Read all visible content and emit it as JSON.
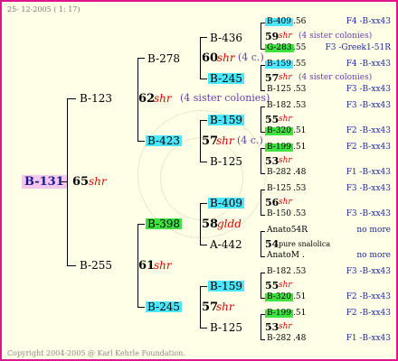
{
  "header": "25- 12-2005 ( 1: 17)",
  "footer": "Copyright 2004-2005 @ Karl Kehrle Foundation.",
  "root": {
    "code": "B-131",
    "gen": "65",
    "label": "shr"
  },
  "gen1": [
    {
      "code": "B-123",
      "gen": "62",
      "label": "shr",
      "note": "(4 sister colonies)"
    },
    {
      "code": "B-255",
      "gen": "61",
      "label": "shr"
    }
  ],
  "gen2": [
    {
      "code": "B-278",
      "gen": "60",
      "label": "shr",
      "note": "(4 c.)"
    },
    {
      "code": "B-423",
      "gen": "57",
      "label": "shr",
      "note": "(4 c.)"
    },
    {
      "code": "B-398",
      "gen": "58",
      "label": "gldd"
    },
    {
      "code": "B-245",
      "gen": "57",
      "label": "shr"
    }
  ],
  "gen3": [
    {
      "code": "B-436",
      "gen": "59",
      "label": "shr",
      "note": "(4 sister colonies)"
    },
    {
      "code": "B-245",
      "gen": "57",
      "label": "shr",
      "note": "(4 sister colonies)"
    },
    {
      "code": "B-159",
      "gen": "55",
      "label": "shr"
    },
    {
      "code": "B-125",
      "gen": "53",
      "label": "shr"
    },
    {
      "code": "B-409",
      "gen": "56",
      "label": "shr"
    },
    {
      "code": "A-442",
      "gen": "54",
      "label": "pure snalolica"
    },
    {
      "code": "B-159",
      "gen": "55",
      "label": "shr"
    },
    {
      "code": "B-125",
      "gen": "53",
      "label": "shr"
    }
  ],
  "gen4": [
    {
      "code": "B-409",
      "val": ".56",
      "right": "F4 -B-xx43"
    },
    {
      "code": "G-283",
      "val": ".55",
      "right": "F3 -Greek1-51R"
    },
    {
      "code": "B-159",
      "val": ".55",
      "right": "F4 -B-xx43"
    },
    {
      "code": "B-125",
      "val": ".53",
      "right": "F3 -B-xx43"
    },
    {
      "code": "B-182",
      "val": ".53",
      "right": "F3 -B-xx43"
    },
    {
      "code": "B-320",
      "val": ".51",
      "right": "F2 -B-xx43"
    },
    {
      "code": "B-199",
      "val": ".51",
      "right": "F2 -B-xx43"
    },
    {
      "code": "B-282",
      "val": ".48",
      "right": "F1 -B-xx43"
    },
    {
      "code": "B-125",
      "val": ".53",
      "right": "F3 -B-xx43"
    },
    {
      "code": "B-150",
      "val": ".53",
      "right": "F3 -B-xx43"
    },
    {
      "code": "Anato54R",
      "val": ".",
      "right": "no more"
    },
    {
      "code": "AnatoM",
      "val": ".",
      "right": "no more"
    },
    {
      "code": "B-182",
      "val": ".53",
      "right": "F3 -B-xx43"
    },
    {
      "code": "B-320",
      "val": ".51",
      "right": "F2 -B-xx43"
    },
    {
      "code": "B-199",
      "val": ".51",
      "right": "F2 -B-xx43"
    },
    {
      "code": "B-282",
      "val": ".48",
      "right": "F1 -B-xx43"
    }
  ]
}
